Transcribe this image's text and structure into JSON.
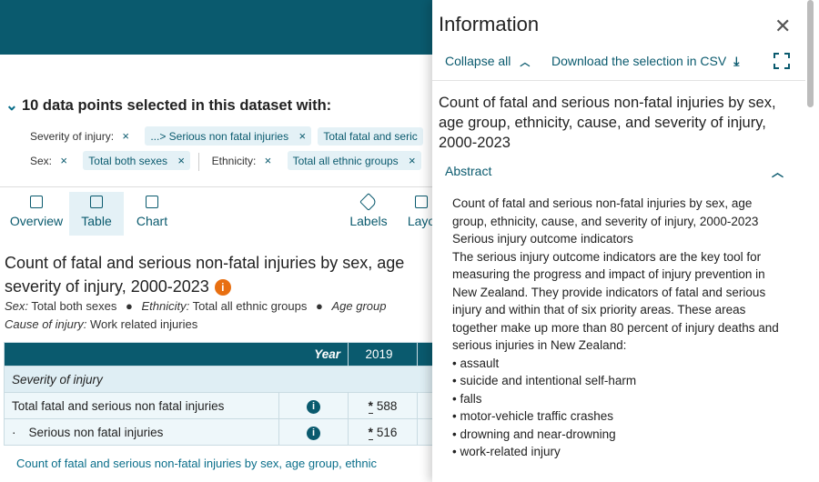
{
  "selection": {
    "heading": "10 data points selected in this dataset with:",
    "filters_row1": {
      "key": "Severity of injury:",
      "values": [
        "...> Serious non fatal injuries",
        "Total fatal and seric"
      ]
    },
    "filters_row2": [
      {
        "key": "Sex:",
        "values": [
          "Total both sexes"
        ]
      },
      {
        "key": "Ethnicity:",
        "values": [
          "Total all ethnic groups"
        ]
      }
    ]
  },
  "tabs": [
    {
      "label": "Overview",
      "icon": "overview-icon"
    },
    {
      "label": "Table",
      "icon": "table-icon"
    },
    {
      "label": "Chart",
      "icon": "chart-icon"
    },
    {
      "label": "Labels",
      "icon": "tag-icon"
    },
    {
      "label": "Layo",
      "icon": "layout-icon"
    }
  ],
  "table_view": {
    "title": "Count of fatal and serious non-fatal injuries by sex, age severity of injury, 2000-2023",
    "meta1": [
      {
        "key": "Sex:",
        "value": "Total both sexes"
      },
      {
        "key": "Ethnicity:",
        "value": "Total all ethnic groups"
      },
      {
        "key": "Age group",
        "value": ""
      }
    ],
    "meta2": {
      "key": "Cause of injury:",
      "value": "Work related injuries"
    },
    "header": {
      "year_label": "Year",
      "col_2019": "2019"
    },
    "group_label": "Severity of injury",
    "rows": [
      {
        "label": "Total fatal and serious non fatal injuries",
        "value": "588",
        "flag": "*"
      },
      {
        "label": "Serious non fatal injuries",
        "value": "516",
        "flag": "*"
      }
    ],
    "footnote": "Count of fatal and serious non-fatal injuries by sex, age group, ethnic"
  },
  "panel": {
    "title": "Information",
    "collapse_label": "Collapse all",
    "download_label": "Download the selection in CSV",
    "dataset_title": "Count of fatal and serious non-fatal injuries by sex, age group, ethnicity, cause, and severity of injury, 2000-2023",
    "abstract_label": "Abstract",
    "abstract_lines": [
      "Count of fatal and serious non-fatal injuries by sex, age group, ethnicity, cause, and severity of injury, 2000-2023",
      "Serious injury outcome indicators",
      "The serious injury outcome indicators are the key tool for measuring the progress and impact of injury prevention in New Zealand. They provide indicators of fatal and serious injury and within that of six priority areas. These areas together make up more than 80 percent of injury deaths and serious injuries in New Zealand:",
      "• assault",
      "• suicide and intentional self-harm",
      "• falls",
      "• motor-vehicle traffic crashes",
      "• drowning and near-drowning",
      "• work-related injury"
    ]
  },
  "colors": {
    "brand": "#0a5a6e",
    "chip_bg": "#e4f1f6",
    "warn": "#e86f11"
  }
}
